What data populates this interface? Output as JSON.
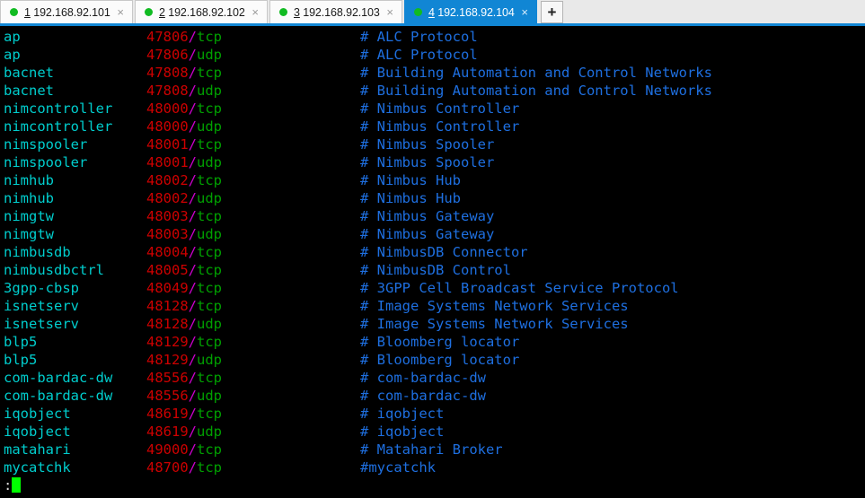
{
  "window": {
    "kind": "ssh-terminal-multiplexer"
  },
  "tabbar": {
    "new_tab_label": "+",
    "close_glyph": "×",
    "active_index": 3,
    "accent_color": "#1186d4",
    "status_dot_color": "#11bb22",
    "tabs": [
      {
        "index": "1",
        "host": "192.168.92.101",
        "active": false
      },
      {
        "index": "2",
        "host": "192.168.92.102",
        "active": false
      },
      {
        "index": "3",
        "host": "192.168.92.103",
        "active": false
      },
      {
        "index": "4",
        "host": "192.168.92.104",
        "active": true
      }
    ]
  },
  "terminal": {
    "colors": {
      "background": "#000000",
      "service": "#00cdcd",
      "port": "#cd0000",
      "separator": "#cd00cd",
      "protocol": "#00a000",
      "comment": "#1e6fe0",
      "cursor": "#00ff00",
      "prompt": "#d8d8d8"
    },
    "prompt": ":",
    "rows": [
      {
        "service": "ap",
        "port": "47806",
        "proto": "tcp",
        "comment": "# ALC Protocol"
      },
      {
        "service": "ap",
        "port": "47806",
        "proto": "udp",
        "comment": "# ALC Protocol"
      },
      {
        "service": "bacnet",
        "port": "47808",
        "proto": "tcp",
        "comment": "# Building Automation and Control Networks"
      },
      {
        "service": "bacnet",
        "port": "47808",
        "proto": "udp",
        "comment": "# Building Automation and Control Networks"
      },
      {
        "service": "nimcontroller",
        "port": "48000",
        "proto": "tcp",
        "comment": "# Nimbus Controller"
      },
      {
        "service": "nimcontroller",
        "port": "48000",
        "proto": "udp",
        "comment": "# Nimbus Controller"
      },
      {
        "service": "nimspooler",
        "port": "48001",
        "proto": "tcp",
        "comment": "# Nimbus Spooler"
      },
      {
        "service": "nimspooler",
        "port": "48001",
        "proto": "udp",
        "comment": "# Nimbus Spooler"
      },
      {
        "service": "nimhub",
        "port": "48002",
        "proto": "tcp",
        "comment": "# Nimbus Hub"
      },
      {
        "service": "nimhub",
        "port": "48002",
        "proto": "udp",
        "comment": "# Nimbus Hub"
      },
      {
        "service": "nimgtw",
        "port": "48003",
        "proto": "tcp",
        "comment": "# Nimbus Gateway"
      },
      {
        "service": "nimgtw",
        "port": "48003",
        "proto": "udp",
        "comment": "# Nimbus Gateway"
      },
      {
        "service": "nimbusdb",
        "port": "48004",
        "proto": "tcp",
        "comment": "# NimbusDB Connector"
      },
      {
        "service": "nimbusdbctrl",
        "port": "48005",
        "proto": "tcp",
        "comment": "# NimbusDB Control"
      },
      {
        "service": "3gpp-cbsp",
        "port": "48049",
        "proto": "tcp",
        "comment": "# 3GPP Cell Broadcast Service Protocol"
      },
      {
        "service": "isnetserv",
        "port": "48128",
        "proto": "tcp",
        "comment": "# Image Systems Network Services"
      },
      {
        "service": "isnetserv",
        "port": "48128",
        "proto": "udp",
        "comment": "# Image Systems Network Services"
      },
      {
        "service": "blp5",
        "port": "48129",
        "proto": "tcp",
        "comment": "# Bloomberg locator"
      },
      {
        "service": "blp5",
        "port": "48129",
        "proto": "udp",
        "comment": "# Bloomberg locator"
      },
      {
        "service": "com-bardac-dw",
        "port": "48556",
        "proto": "tcp",
        "comment": "# com-bardac-dw"
      },
      {
        "service": "com-bardac-dw",
        "port": "48556",
        "proto": "udp",
        "comment": "# com-bardac-dw"
      },
      {
        "service": "iqobject",
        "port": "48619",
        "proto": "tcp",
        "comment": "# iqobject"
      },
      {
        "service": "iqobject",
        "port": "48619",
        "proto": "udp",
        "comment": "# iqobject"
      },
      {
        "service": "matahari",
        "port": "49000",
        "proto": "tcp",
        "comment": "# Matahari Broker"
      },
      {
        "service": "mycatchk",
        "port": "48700",
        "proto": "tcp",
        "comment": "#mycatchk"
      }
    ]
  }
}
